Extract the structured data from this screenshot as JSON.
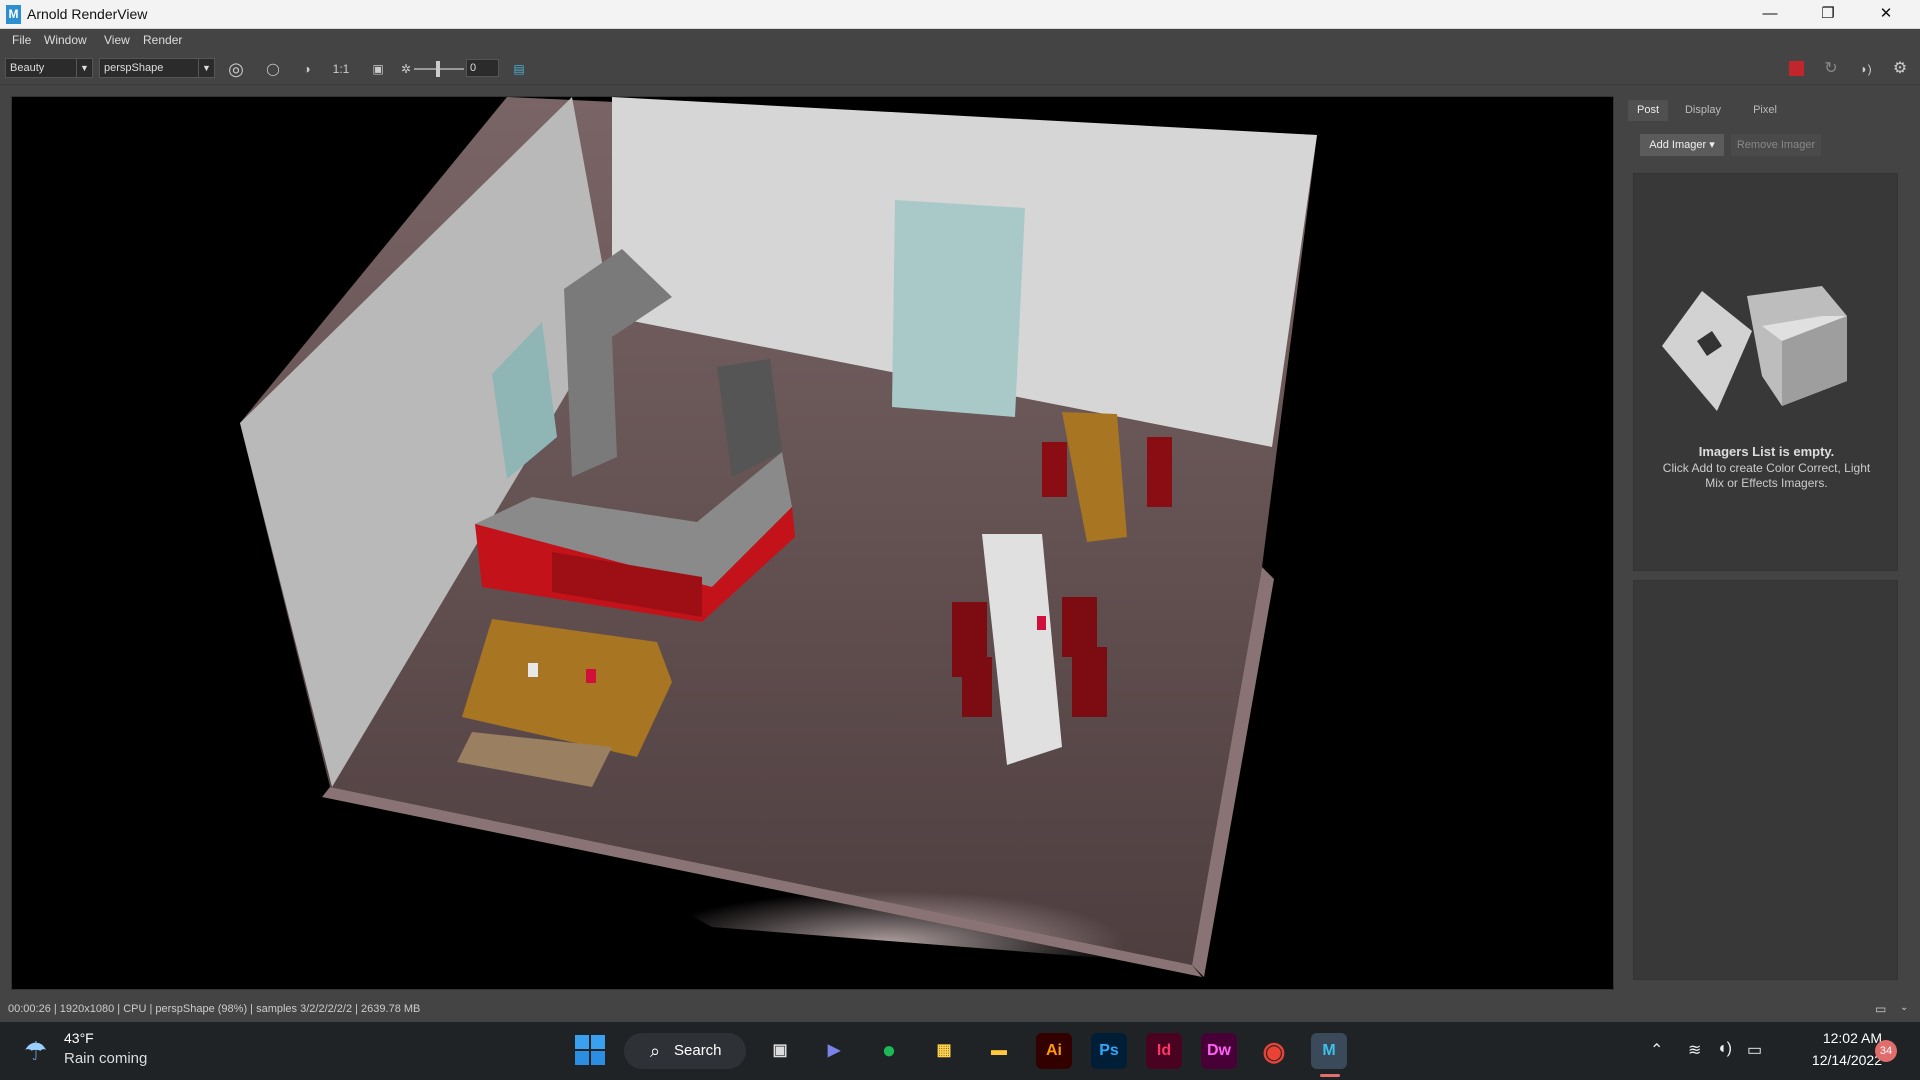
{
  "window": {
    "title": "Arnold RenderView",
    "icon_letter": "M",
    "min": "—",
    "restore": "❐",
    "close": "✕"
  },
  "menu": [
    "File",
    "Window",
    "View",
    "Render"
  ],
  "toolbar": {
    "aov": "Beauty",
    "camera": "perspShape",
    "ratio": "1:1",
    "exposure": "0"
  },
  "side": {
    "tabs": [
      "Post",
      "Display",
      "Pixel"
    ],
    "add_imager": "Add Imager",
    "remove_imager": "Remove Imager",
    "empty_title": "Imagers List is empty.",
    "empty_sub": "Click Add to create Color Correct, Light Mix or Effects Imagers."
  },
  "status": "00:00:26 |  1920x1080 | CPU | perspShape (98%) | samples 3/2/2/2/2/2 | 2639.78 MB",
  "taskbar": {
    "temp": "43°F",
    "weather": "Rain coming",
    "search": "Search",
    "time": "12:02 AM",
    "date": "12/14/2022",
    "badge": "34",
    "apps": [
      {
        "name": "Ai",
        "color": "#330000",
        "fg": "#ff9a00"
      },
      {
        "name": "Ps",
        "color": "#001e36",
        "fg": "#31a8ff"
      },
      {
        "name": "Id",
        "color": "#49021f",
        "fg": "#ff3366"
      },
      {
        "name": "Dw",
        "color": "#470137",
        "fg": "#ff61f6"
      }
    ]
  }
}
